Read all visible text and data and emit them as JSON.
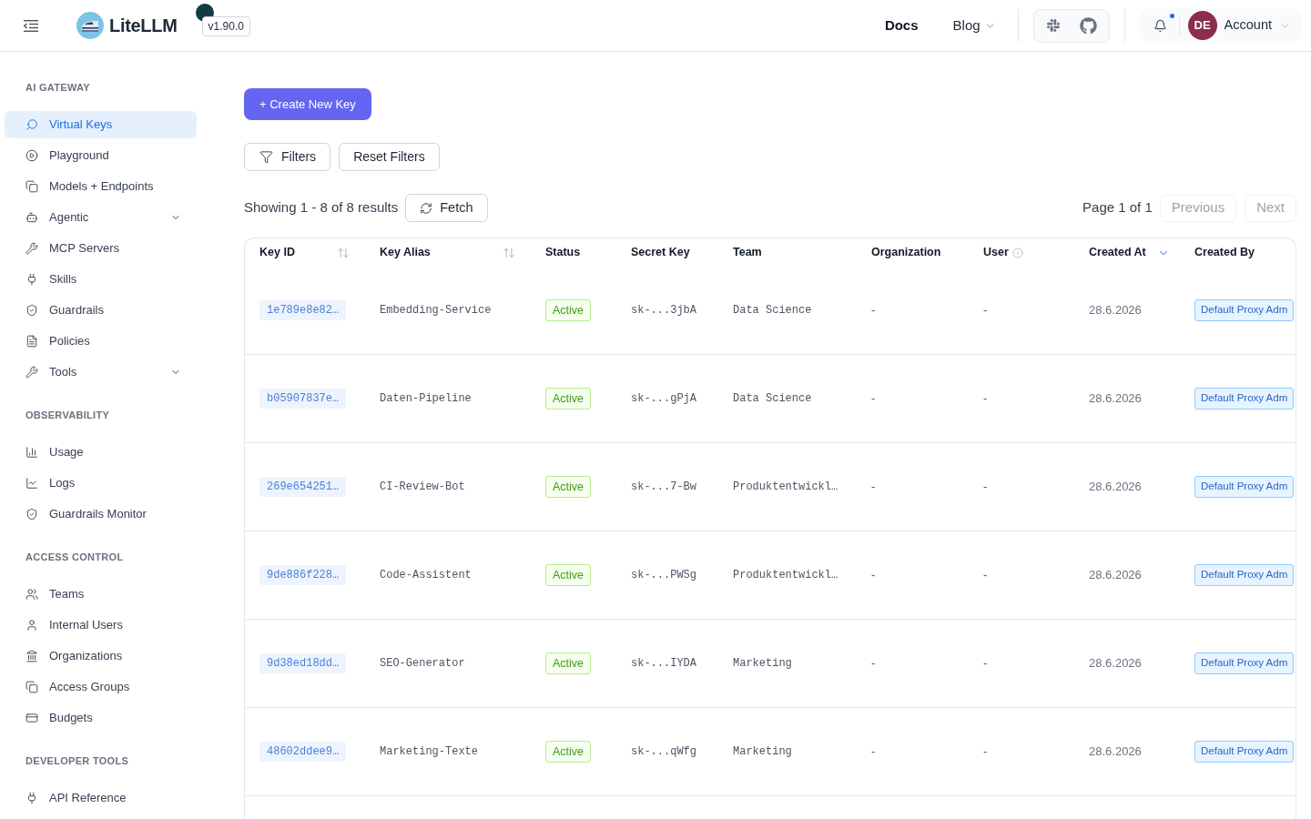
{
  "header": {
    "brand": "LiteLLM",
    "version": "v1.90.0",
    "links": [
      {
        "label": "Docs",
        "dropdown": false
      },
      {
        "label": "Blog",
        "dropdown": true
      }
    ],
    "notification_dot": true,
    "account": {
      "initials": "DE",
      "label": "Account"
    }
  },
  "sidebar": {
    "sections": [
      {
        "title": "AI GATEWAY",
        "items": [
          {
            "label": "Virtual Keys",
            "selected": true,
            "expandable": false
          },
          {
            "label": "Playground",
            "selected": false,
            "expandable": false
          },
          {
            "label": "Models + Endpoints",
            "selected": false,
            "expandable": false
          },
          {
            "label": "Agentic",
            "selected": false,
            "expandable": true
          },
          {
            "label": "MCP Servers",
            "selected": false,
            "expandable": false
          },
          {
            "label": "Skills",
            "selected": false,
            "expandable": false
          },
          {
            "label": "Guardrails",
            "selected": false,
            "expandable": false
          },
          {
            "label": "Policies",
            "selected": false,
            "expandable": false
          },
          {
            "label": "Tools",
            "selected": false,
            "expandable": true
          }
        ]
      },
      {
        "title": "OBSERVABILITY",
        "items": [
          {
            "label": "Usage",
            "selected": false,
            "expandable": false
          },
          {
            "label": "Logs",
            "selected": false,
            "expandable": false
          },
          {
            "label": "Guardrails Monitor",
            "selected": false,
            "expandable": false
          }
        ]
      },
      {
        "title": "ACCESS CONTROL",
        "items": [
          {
            "label": "Teams",
            "selected": false,
            "expandable": false
          },
          {
            "label": "Internal Users",
            "selected": false,
            "expandable": false
          },
          {
            "label": "Organizations",
            "selected": false,
            "expandable": false
          },
          {
            "label": "Access Groups",
            "selected": false,
            "expandable": false
          },
          {
            "label": "Budgets",
            "selected": false,
            "expandable": false
          }
        ]
      },
      {
        "title": "DEVELOPER TOOLS",
        "items": [
          {
            "label": "API Reference",
            "selected": false,
            "expandable": false
          }
        ]
      }
    ]
  },
  "toolbar": {
    "create_button": "+ Create New Key",
    "filters_button": "Filters",
    "reset_button": "Reset Filters"
  },
  "results": {
    "summary": "Showing 1 - 8 of 8 results",
    "fetch_button": "Fetch",
    "page_label": "Page 1 of 1",
    "previous": {
      "label": "Previous",
      "disabled": true
    },
    "next": {
      "label": "Next",
      "disabled": true
    }
  },
  "table": {
    "columns": [
      {
        "label": "Key ID",
        "kind": "id",
        "sortable": true,
        "sorted": false,
        "info": false
      },
      {
        "label": "Key Alias",
        "kind": "mono",
        "sortable": true,
        "sorted": false,
        "info": false
      },
      {
        "label": "Status",
        "kind": "status",
        "sortable": false,
        "sorted": false,
        "info": false
      },
      {
        "label": "Secret Key",
        "kind": "mono",
        "sortable": false,
        "sorted": false,
        "info": false
      },
      {
        "label": "Team",
        "kind": "mono",
        "sortable": false,
        "sorted": false,
        "info": false
      },
      {
        "label": "Organization",
        "kind": "plain",
        "sortable": false,
        "sorted": false,
        "info": false
      },
      {
        "label": "User",
        "kind": "plain",
        "sortable": false,
        "sorted": false,
        "info": true
      },
      {
        "label": "Created At",
        "kind": "date",
        "sortable": false,
        "sorted": true,
        "info": false
      },
      {
        "label": "Created By",
        "kind": "tag",
        "sortable": false,
        "sorted": false,
        "info": false
      }
    ],
    "rows": [
      {
        "cells": [
          "1e789e8e82…",
          "Embedding-Service",
          "Active",
          "sk-...3jbA",
          "Data Science",
          "-",
          "-",
          "28.6.2026",
          "Default Proxy Adm"
        ]
      },
      {
        "cells": [
          "b05907837e…",
          "Daten-Pipeline",
          "Active",
          "sk-...gPjA",
          "Data Science",
          "-",
          "-",
          "28.6.2026",
          "Default Proxy Adm"
        ]
      },
      {
        "cells": [
          "269e654251…",
          "CI-Review-Bot",
          "Active",
          "sk-...7-Bw",
          "Produktentwickl…",
          "-",
          "-",
          "28.6.2026",
          "Default Proxy Adm"
        ]
      },
      {
        "cells": [
          "9de886f228…",
          "Code-Assistent",
          "Active",
          "sk-...PWSg",
          "Produktentwickl…",
          "-",
          "-",
          "28.6.2026",
          "Default Proxy Adm"
        ]
      },
      {
        "cells": [
          "9d38ed18dd…",
          "SEO-Generator",
          "Active",
          "sk-...IYDA",
          "Marketing",
          "-",
          "-",
          "28.6.2026",
          "Default Proxy Adm"
        ]
      },
      {
        "cells": [
          "48602ddee9…",
          "Marketing-Texte",
          "Active",
          "sk-...qWfg",
          "Marketing",
          "-",
          "-",
          "28.6.2026",
          "Default Proxy Adm"
        ]
      }
    ]
  }
}
